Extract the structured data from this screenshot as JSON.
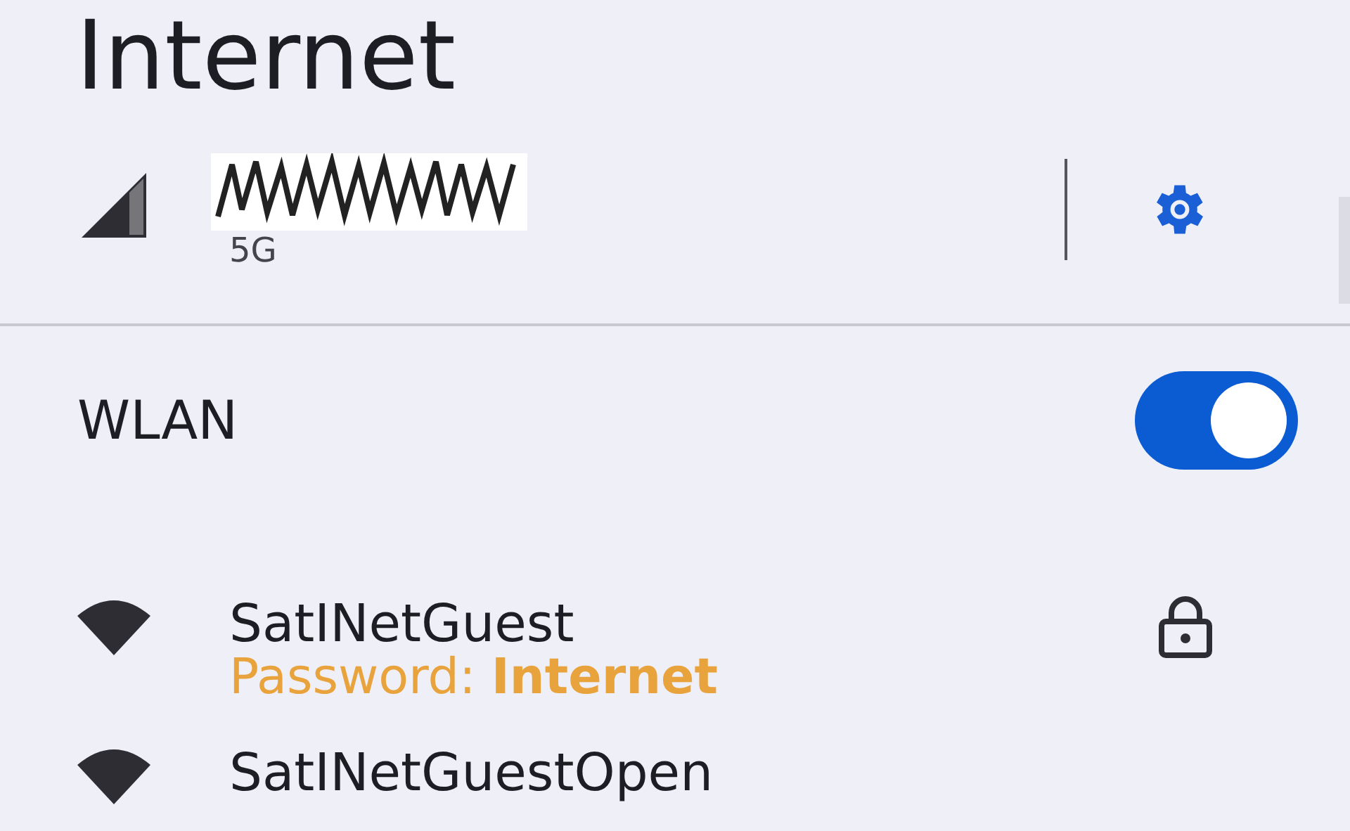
{
  "title": "Internet",
  "mobile": {
    "network_type": "5G"
  },
  "wlan": {
    "label": "WLAN",
    "on": true
  },
  "networks": [
    {
      "name": "SatINetGuest",
      "detail": "Password: **Internet**",
      "secured": true
    },
    {
      "name": "SatINetGuestOpen",
      "secured": false
    }
  ]
}
